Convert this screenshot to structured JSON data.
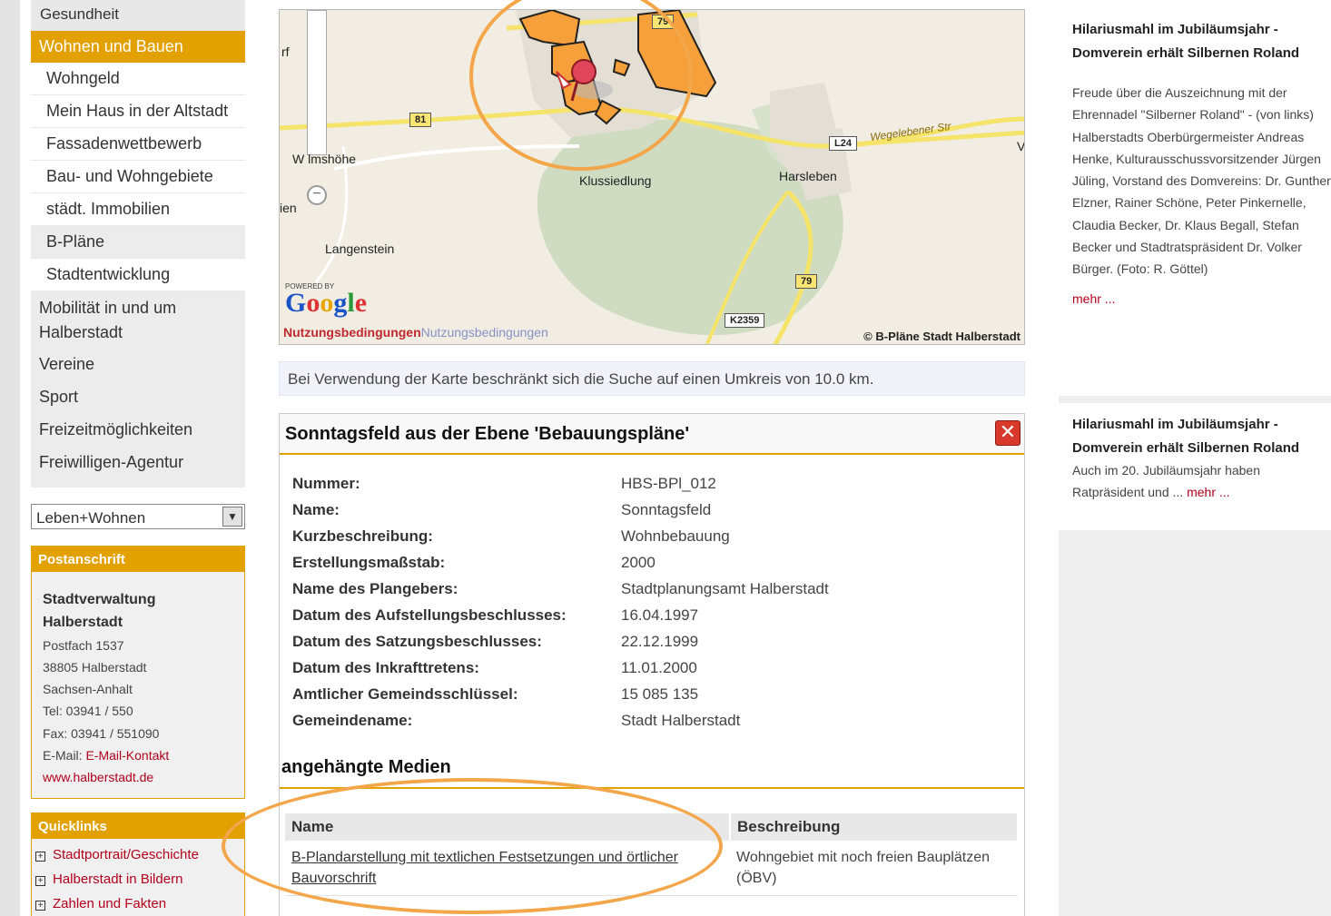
{
  "nav": {
    "top_item": "Gesundheit",
    "active_item": "Wohnen und Bauen",
    "sub_items": [
      "Wohngeld",
      "Mein Haus in der Altstadt",
      "Fassadenwettbewerb",
      "Bau- und Wohngebiete",
      "städt. Immobilien",
      "B-Pläne",
      "Stadtentwicklung"
    ],
    "main_items": [
      "Mobilität in und um Halberstadt",
      "Vereine",
      "Sport",
      "Freizeitmöglichkeiten",
      "Freiwilligen-Agentur"
    ],
    "select_value": "Leben+Wohnen"
  },
  "address": {
    "title": "Postanschrift",
    "org1": "Stadtverwaltung",
    "org2": "Halberstadt",
    "lines": [
      "Postfach 1537",
      "38805 Halberstadt",
      "Sachsen-Anhalt",
      "Tel: 03941 / 550",
      "Fax: 03941 / 551090"
    ],
    "email_label": "E-Mail:",
    "email_link": "E-Mail-Kontakt",
    "web": "www.halberstadt.de"
  },
  "quicklinks": {
    "title": "Quicklinks",
    "items": [
      "Stadtportrait/Geschichte",
      "Halberstadt in Bildern",
      "Zahlen und Fakten"
    ]
  },
  "map": {
    "labels": {
      "wilhelmshoehe": "W    lmshöhe",
      "klussiedlung": "Klussiedlung",
      "harsleben": "Harsleben",
      "langenstein": "Langenstein",
      "wegeleben": "Wegelebener Str",
      "rf": "rf",
      "en": "ien",
      "v": "V"
    },
    "signs": [
      "81",
      "L24",
      "79",
      "K2359",
      "79"
    ],
    "powered_by": "POWERED BY",
    "google": "Google",
    "terms": "Nutzungsbedingungen",
    "terms_ghost": "Nutzungsbedingungen",
    "copyright": "© B-Pläne Stadt Halberstadt"
  },
  "radius_note": "Bei Verwendung der Karte beschränkt sich die Suche auf einen Umkreis von 10.0 km.",
  "detail": {
    "title": "Sonntagsfeld aus der Ebene 'Bebauungspläne'",
    "close_glyph": "✕",
    "attributes": [
      {
        "key": "Nummer:",
        "value": "HBS-BPl_012"
      },
      {
        "key": "Name:",
        "value": "Sonntagsfeld"
      },
      {
        "key": "Kurzbeschreibung:",
        "value": "Wohnbebauung"
      },
      {
        "key": "Erstellungsmaßstab:",
        "value": "2000"
      },
      {
        "key": "Name des Plangebers:",
        "value": "Stadtplanungsamt Halberstadt"
      },
      {
        "key": "Datum des Aufstellungsbeschlusses:",
        "value": "16.04.1997"
      },
      {
        "key": "Datum des Satzungsbeschlusses:",
        "value": "22.12.1999"
      },
      {
        "key": "Datum des Inkrafttretens:",
        "value": "11.01.2000"
      },
      {
        "key": "Amtlicher Gemeindsschlüssel:",
        "value": "15 085 135"
      },
      {
        "key": "Gemeindename:",
        "value": "Stadt Halberstadt"
      }
    ],
    "media_title": "angehängte Medien",
    "media_headers": [
      "Name",
      "Beschreibung"
    ],
    "media_rows": [
      {
        "name": "B-Plandarstellung mit textlichen Festsetzungen und örtlicher Bauvorschrift",
        "desc": "Wohngebiet mit noch freien Bauplätzen (ÖBV)"
      }
    ]
  },
  "news": [
    {
      "title": "Hilariusmahl im Jubiläumsjahr - Domverein erhält Silbernen Roland",
      "body": "Freude über die Auszeichnung mit der Ehrennadel \"Silberner Roland\" - (von links) Halberstadts Oberbürgermeister Andreas Henke, Kulturausschussvorsitzender Jürgen Jüling, Vorstand des Domvereins: Dr. Gunther Elzner, Rainer Schöne, Peter Pinkernelle, Claudia Becker, Dr. Klaus Begall, Stefan Becker und Stadtratspräsident Dr. Volker Bürger. (Foto: R. Göttel)",
      "more": "mehr ..."
    },
    {
      "title": "Hilariusmahl im Jubiläumsjahr - Domverein erhält Silbernen Roland",
      "body": "Auch im 20. Jubiläumsjahr haben Ratpräsident und ...",
      "more": "mehr ..."
    }
  ]
}
